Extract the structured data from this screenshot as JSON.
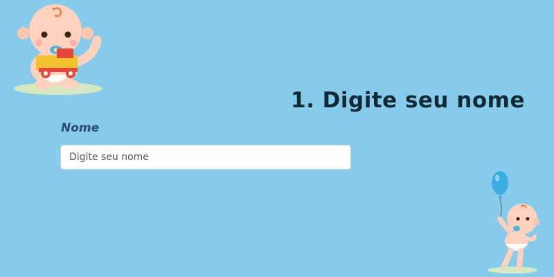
{
  "step": {
    "title": "1. Digite seu nome"
  },
  "form": {
    "name_label": "Nome",
    "name_value": "",
    "name_placeholder": "Digite seu nome"
  },
  "illustrations": {
    "top_left": "baby-with-toy-car",
    "bottom_right": "baby-with-balloon"
  },
  "colors": {
    "background": "#87cbea",
    "title": "#0e2a38",
    "label": "#2c4b79",
    "input_bg": "#ffffff"
  }
}
